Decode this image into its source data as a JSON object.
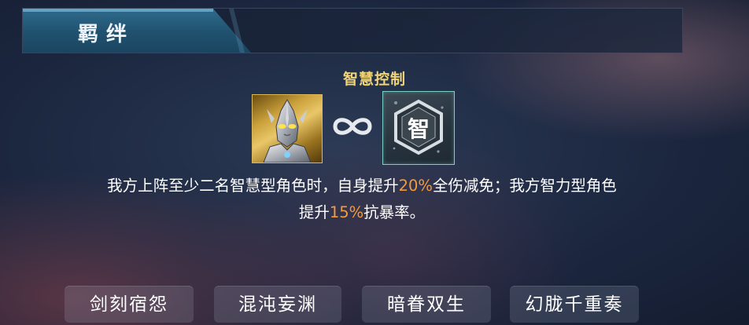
{
  "header": {
    "title": "羁绊"
  },
  "combo": {
    "name": "智慧控制",
    "wisdom_badge": "智",
    "description": {
      "line1_part1": "我方上阵至少二名智慧型角色时，自身提升",
      "line1_value1": "20%",
      "line1_part2": "全伤减免；我方智力型角色",
      "line2_part1": "提升",
      "line2_value2": "15%",
      "line2_part2": "抗暴率。"
    }
  },
  "tabs": [
    {
      "label": "剑刻宿怨"
    },
    {
      "label": "混沌妄渊"
    },
    {
      "label": "暗眷双生"
    },
    {
      "label": "幻胧千重奏"
    }
  ],
  "colors": {
    "combo_name": "#f0d47a",
    "highlight": "#f39a3f",
    "header_tab": "#20516f"
  },
  "icons": [
    "character-portrait",
    "infinity-link-icon",
    "wisdom-type-icon"
  ]
}
